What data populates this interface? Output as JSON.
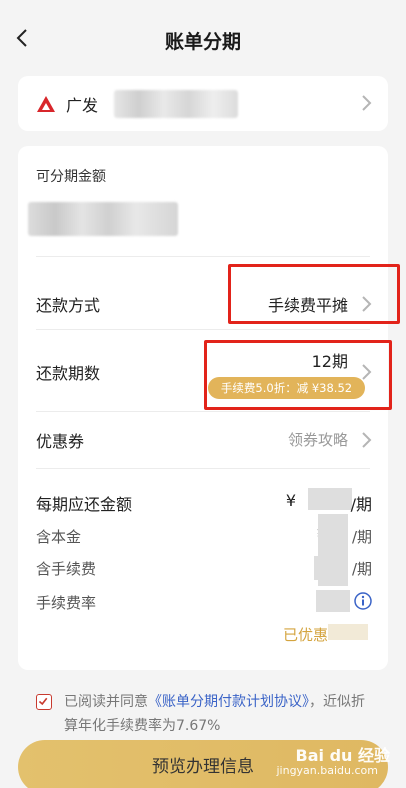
{
  "status_bar": {
    "left_text": "",
    "right_text": ""
  },
  "header": {
    "title": "账单分期"
  },
  "bank": {
    "name": "广发"
  },
  "amount": {
    "label": "可分期金额"
  },
  "repayment_method": {
    "label": "还款方式",
    "value": "手续费平摊"
  },
  "periods": {
    "label": "还款期数",
    "value": "12期",
    "discount_text": "手续费5.0折：减 ¥38.52"
  },
  "coupon": {
    "label": "优惠券",
    "value": "领券攻略"
  },
  "per_period": {
    "label": "每期应还金额",
    "value_prefix": "¥",
    "value_suffix": "/期"
  },
  "principal": {
    "label": "含本金",
    "value_prefix": "¥",
    "value_suffix": "/期"
  },
  "fee": {
    "label": "含手续费",
    "value_suffix": "/期"
  },
  "fee_rate": {
    "label": "手续费率",
    "value_prefix": "("
  },
  "discounted": {
    "label": "已优惠"
  },
  "agreement": {
    "prefix": "已阅读并同意",
    "link": "《账单分期付款计划协议》",
    "suffix": "，近似折算年化手续费率为7.67%"
  },
  "cta": {
    "label": "预览办理信息"
  },
  "watermark": {
    "brand": "Bai du 经验",
    "url": "jingyan.baidu.com"
  },
  "colors": {
    "accent_gold": "#e2b45a",
    "highlight_red": "#e2231a",
    "link_blue": "#3a63c7",
    "bank_red": "#d8262b"
  }
}
